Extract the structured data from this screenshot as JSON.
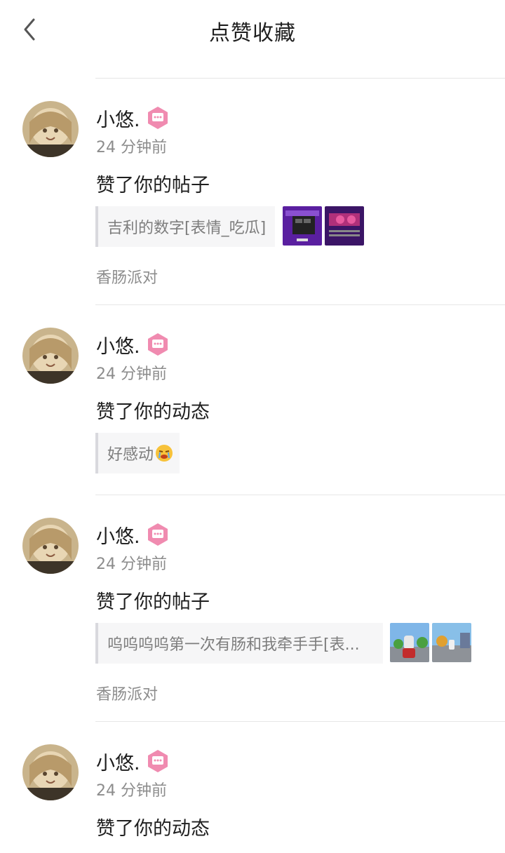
{
  "header": {
    "title": "点赞收藏",
    "back_icon": "chevron-left-icon"
  },
  "colors": {
    "badge_pink": "#f08bb0",
    "quote_bar": "#d9d9de",
    "muted_text": "#8c8c8c"
  },
  "notifications": [
    {
      "user": "小悠.",
      "time": "24 分钟前",
      "action": "赞了你的帖子",
      "quote": "吉利的数字[表情_吃瓜]",
      "source": "香肠派对",
      "thumbnails": 2
    },
    {
      "user": "小悠.",
      "time": "24 分钟前",
      "action": "赞了你的动态",
      "quote": "好感动",
      "quote_emoji": "crying-emoji-icon",
      "thumbnails": 0
    },
    {
      "user": "小悠.",
      "time": "24 分钟前",
      "action": "赞了你的帖子",
      "quote": "呜呜呜呜第一次有肠和我牵手手[表...",
      "source": "香肠派对",
      "thumbnails": 2
    },
    {
      "user": "小悠.",
      "time": "24 分钟前",
      "action": "赞了你的动态"
    }
  ]
}
